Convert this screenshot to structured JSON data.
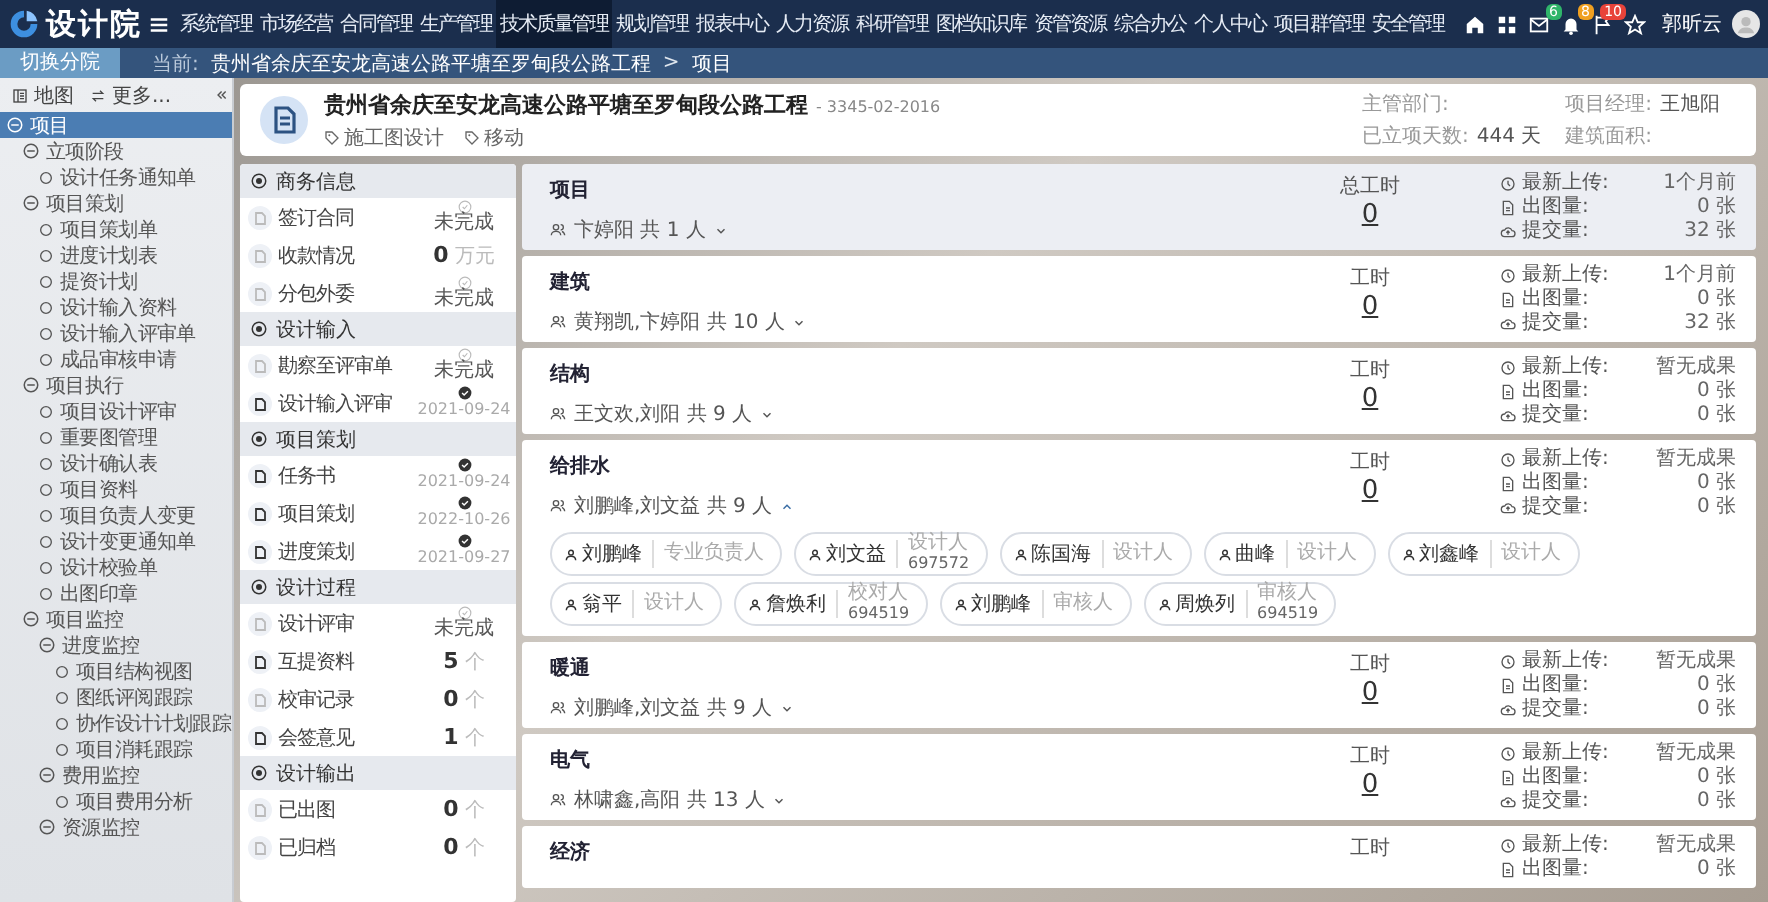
{
  "top_bar": {
    "logo": "设计院",
    "menu": [
      {
        "label": "系统管理",
        "selected": false
      },
      {
        "label": "市场经营",
        "selected": false
      },
      {
        "label": "合同管理",
        "selected": false
      },
      {
        "label": "生产管理",
        "selected": false
      },
      {
        "label": "技术质量管理",
        "selected": true
      },
      {
        "label": "规划管理",
        "selected": false
      },
      {
        "label": "报表中心",
        "selected": false
      },
      {
        "label": "人力资源",
        "selected": false
      },
      {
        "label": "科研管理",
        "selected": false
      },
      {
        "label": "图档知识库",
        "selected": false
      },
      {
        "label": "资管资源",
        "selected": false
      },
      {
        "label": "综合办公",
        "selected": false
      },
      {
        "label": "个人中心",
        "selected": false
      },
      {
        "label": "项目群管理",
        "selected": false
      },
      {
        "label": "安全管理",
        "selected": false
      }
    ],
    "tools": [
      {
        "kind": "home"
      },
      {
        "kind": "grid"
      },
      {
        "kind": "mail",
        "count": "6",
        "color": "#2fb56a"
      },
      {
        "kind": "bell",
        "count": "8",
        "color": "#f0a020"
      },
      {
        "kind": "flag",
        "count": "10",
        "color": "#e8433a"
      },
      {
        "kind": "star"
      }
    ],
    "user": "郭昕云"
  },
  "breadcrumb": {
    "button": "切换分院",
    "label": "当前:",
    "separator": ">",
    "path": [
      "贵州省余庆至安龙高速公路平塘至罗甸段公路工程",
      "项目"
    ]
  },
  "sidebar": {
    "tabs": [
      {
        "kind": "list",
        "label": "地图"
      },
      {
        "kind": "swap",
        "label": "更多..."
      }
    ],
    "items": [
      {
        "label": "项目",
        "selected": true,
        "expanded": true,
        "children": [
          {
            "label": "立项阶段",
            "selected": false,
            "expanded": true,
            "children": [
              {
                "label": "设计任务通知单",
                "selected": false
              }
            ]
          },
          {
            "label": "项目策划",
            "selected": false,
            "expanded": true,
            "children": [
              {
                "label": "项目策划单",
                "selected": false
              },
              {
                "label": "进度计划表",
                "selected": false
              },
              {
                "label": "提资计划",
                "selected": false
              },
              {
                "label": "设计输入资料",
                "selected": false
              },
              {
                "label": "设计输入评审单",
                "selected": false
              },
              {
                "label": "成品审核申请",
                "selected": false
              }
            ]
          },
          {
            "label": "项目执行",
            "selected": false,
            "expanded": true,
            "children": [
              {
                "label": "项目设计评审",
                "selected": false
              },
              {
                "label": "重要图管理",
                "selected": false
              },
              {
                "label": "设计确认表",
                "selected": false
              },
              {
                "label": "项目资料",
                "selected": false
              },
              {
                "label": "项目负责人变更",
                "selected": false
              },
              {
                "label": "设计变更通知单",
                "selected": false
              },
              {
                "label": "设计校验单",
                "selected": false
              },
              {
                "label": "出图印章",
                "selected": false
              }
            ]
          },
          {
            "label": "项目监控",
            "selected": false,
            "expanded": true,
            "children": [
              {
                "label": "进度监控",
                "selected": false,
                "expanded": true,
                "children": [
                  {
                    "label": "项目结构视图",
                    "selected": false
                  },
                  {
                    "label": "图纸评阅跟踪",
                    "selected": false
                  },
                  {
                    "label": "协作设计计划跟踪",
                    "selected": false
                  },
                  {
                    "label": "项目消耗跟踪",
                    "selected": false
                  }
                ]
              },
              {
                "label": "费用监控",
                "selected": false,
                "expanded": true,
                "children": [
                  {
                    "label": "项目费用分析",
                    "selected": false
                  }
                ]
              },
              {
                "label": "资源监控",
                "selected": false,
                "expanded": true
              }
            ]
          }
        ]
      }
    ]
  },
  "project": {
    "title": "贵州省余庆至安龙高速公路平塘至罗甸段公路工程",
    "code": "- 3345-02-2016",
    "tags": [
      "施工图设计",
      "移动"
    ],
    "info": [
      [
        {
          "label": "主管部门:"
        },
        {
          "label": "项目经理:",
          "value": "王旭阳"
        }
      ],
      [
        {
          "label": "已立项天数:",
          "value": "444 天"
        },
        {
          "label": "建筑面积:"
        }
      ]
    ]
  },
  "panel": {
    "sections": [
      {
        "title": "商务信息",
        "rows": [
          {
            "kind": "status",
            "label": "签订合同",
            "done": false,
            "value": "未完成",
            "highlighted": false
          },
          {
            "kind": "count",
            "label": "收款情况",
            "value": "0",
            "unit": "万元",
            "highlighted": false
          },
          {
            "kind": "status",
            "label": "分包外委",
            "done": false,
            "value": "未完成",
            "highlighted": false
          }
        ]
      },
      {
        "title": "设计输入",
        "rows": [
          {
            "kind": "status",
            "label": "勘察至评审单",
            "done": false,
            "value": "未完成",
            "highlighted": false
          },
          {
            "kind": "status",
            "label": "设计输入评审",
            "done": true,
            "value": "2021-09-24",
            "highlighted": true
          }
        ]
      },
      {
        "title": "项目策划",
        "rows": [
          {
            "kind": "status",
            "label": "任务书",
            "done": true,
            "value": "2021-09-24",
            "highlighted": true
          },
          {
            "kind": "status",
            "label": "项目策划",
            "done": true,
            "value": "2022-10-26",
            "highlighted": true
          },
          {
            "kind": "status",
            "label": "进度策划",
            "done": true,
            "value": "2021-09-27",
            "highlighted": true
          }
        ]
      },
      {
        "title": "设计过程",
        "rows": [
          {
            "kind": "status",
            "label": "设计评审",
            "done": false,
            "value": "未完成",
            "highlighted": false
          },
          {
            "kind": "count",
            "label": "互提资料",
            "value": "5",
            "unit": "个",
            "highlighted": true
          },
          {
            "kind": "count",
            "label": "校审记录",
            "value": "0",
            "unit": "个",
            "highlighted": false
          },
          {
            "kind": "count",
            "label": "会签意见",
            "value": "1",
            "unit": "个",
            "highlighted": true
          }
        ]
      },
      {
        "title": "设计输出",
        "rows": [
          {
            "kind": "count",
            "label": "已出图",
            "value": "0",
            "unit": "个",
            "highlighted": false
          },
          {
            "kind": "count",
            "label": "已归档",
            "value": "0",
            "unit": "个",
            "highlighted": false
          }
        ]
      }
    ]
  },
  "disciplines": [
    {
      "title": "项目",
      "selected": true,
      "members": "卞婷阳 共 1 人",
      "expanded": false,
      "hours_label": "总工时",
      "hours": "0",
      "stats": [
        {
          "kind": "clock",
          "label": "最新上传:",
          "value": "1个月前"
        },
        {
          "kind": "file",
          "label": "出图量:",
          "value": "0 张"
        },
        {
          "kind": "cloud",
          "label": "提交量:",
          "value": "32 张"
        }
      ]
    },
    {
      "title": "建筑",
      "selected": false,
      "members": "黄翔凯,卞婷阳 共 10 人",
      "expanded": false,
      "hours_label": "工时",
      "hours": "0",
      "stats": [
        {
          "kind": "clock",
          "label": "最新上传:",
          "value": "1个月前"
        },
        {
          "kind": "file",
          "label": "出图量:",
          "value": "0 张"
        },
        {
          "kind": "cloud",
          "label": "提交量:",
          "value": "32 张"
        }
      ]
    },
    {
      "title": "结构",
      "selected": false,
      "members": "王文欢,刘阳 共 9 人",
      "expanded": false,
      "hours_label": "工时",
      "hours": "0",
      "stats": [
        {
          "kind": "clock",
          "label": "最新上传:",
          "value": "暂无成果"
        },
        {
          "kind": "file",
          "label": "出图量:",
          "value": "0 张"
        },
        {
          "kind": "cloud",
          "label": "提交量:",
          "value": "0 张"
        }
      ]
    },
    {
      "title": "给排水",
      "selected": false,
      "members": "刘鹏峰,刘文益 共 9 人",
      "expanded": true,
      "hours_label": "工时",
      "hours": "0",
      "stats": [
        {
          "kind": "clock",
          "label": "最新上传:",
          "value": "暂无成果"
        },
        {
          "kind": "file",
          "label": "出图量:",
          "value": "0 张"
        },
        {
          "kind": "cloud",
          "label": "提交量:",
          "value": "0 张"
        }
      ],
      "chips": [
        {
          "name": "刘鹏峰",
          "role": "专业负责人"
        },
        {
          "name": "刘文益",
          "role": "设计人",
          "number": "697572"
        },
        {
          "name": "陈国海",
          "role": "设计人"
        },
        {
          "name": "曲峰",
          "role": "设计人"
        },
        {
          "name": "刘鑫峰",
          "role": "设计人"
        },
        {
          "name": "翁平",
          "role": "设计人"
        },
        {
          "name": "詹焕利",
          "role": "校对人",
          "number": "694519"
        },
        {
          "name": "刘鹏峰",
          "role": "审核人"
        },
        {
          "name": "周焕列",
          "role": "审核人",
          "number": "694519"
        }
      ]
    },
    {
      "title": "暖通",
      "selected": false,
      "members": "刘鹏峰,刘文益 共 9 人",
      "expanded": false,
      "hours_label": "工时",
      "hours": "0",
      "stats": [
        {
          "kind": "clock",
          "label": "最新上传:",
          "value": "暂无成果"
        },
        {
          "kind": "file",
          "label": "出图量:",
          "value": "0 张"
        },
        {
          "kind": "cloud",
          "label": "提交量:",
          "value": "0 张"
        }
      ]
    },
    {
      "title": "电气",
      "selected": false,
      "members": "林啸鑫,高阳 共 13 人",
      "expanded": false,
      "hours_label": "工时",
      "hours": "0",
      "stats": [
        {
          "kind": "clock",
          "label": "最新上传:",
          "value": "暂无成果"
        },
        {
          "kind": "file",
          "label": "出图量:",
          "value": "0 张"
        },
        {
          "kind": "cloud",
          "label": "提交量:",
          "value": "0 张"
        }
      ]
    },
    {
      "title": "经济",
      "selected": false,
      "hours_label": "工时",
      "stats": [
        {
          "kind": "clock",
          "label": "最新上传:",
          "value": "暂无成果"
        },
        {
          "kind": "file",
          "label": "出图量:",
          "value": "0 张"
        }
      ]
    }
  ]
}
